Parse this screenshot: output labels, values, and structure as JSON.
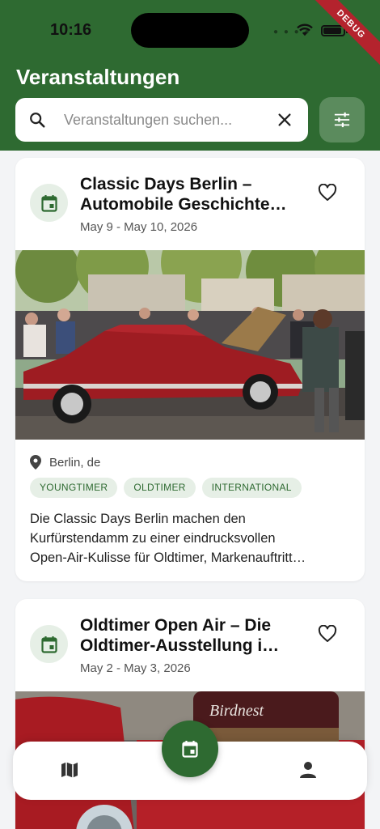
{
  "status_bar": {
    "time": "10:16",
    "debug_label": "DEBUG"
  },
  "header": {
    "title": "Veranstaltungen"
  },
  "search": {
    "placeholder": "Veranstaltungen suchen...",
    "value": ""
  },
  "events": [
    {
      "title_line1": "Classic Days Berlin –",
      "title_line2": "Automobile Geschichte…",
      "dates": "May 9 - May 10, 2026",
      "location": "Berlin, de",
      "tags": [
        "YOUNGTIMER",
        "OLDTIMER",
        "INTERNATIONAL"
      ],
      "description_lines": [
        "Die Classic Days Berlin machen den",
        "Kurfürstendamm zu einer eindrucksvollen",
        "Open-Air-Kulisse für Oldtimer, Markenauftritt…"
      ]
    },
    {
      "title_line1": "Oldtimer Open Air – Die",
      "title_line2": "Oldtimer-Ausstellung i…",
      "dates": "May 2 - May 3, 2026",
      "photo_sign": "Birdnest"
    }
  ],
  "colors": {
    "primary": "#2e6a31",
    "filter_button": "#5b8b5d",
    "tag_bg": "#e6efe6",
    "background": "#f3f4f6"
  },
  "nav": {
    "items": [
      "map-icon",
      "calendar-icon",
      "person-icon"
    ],
    "active": "calendar-icon"
  }
}
